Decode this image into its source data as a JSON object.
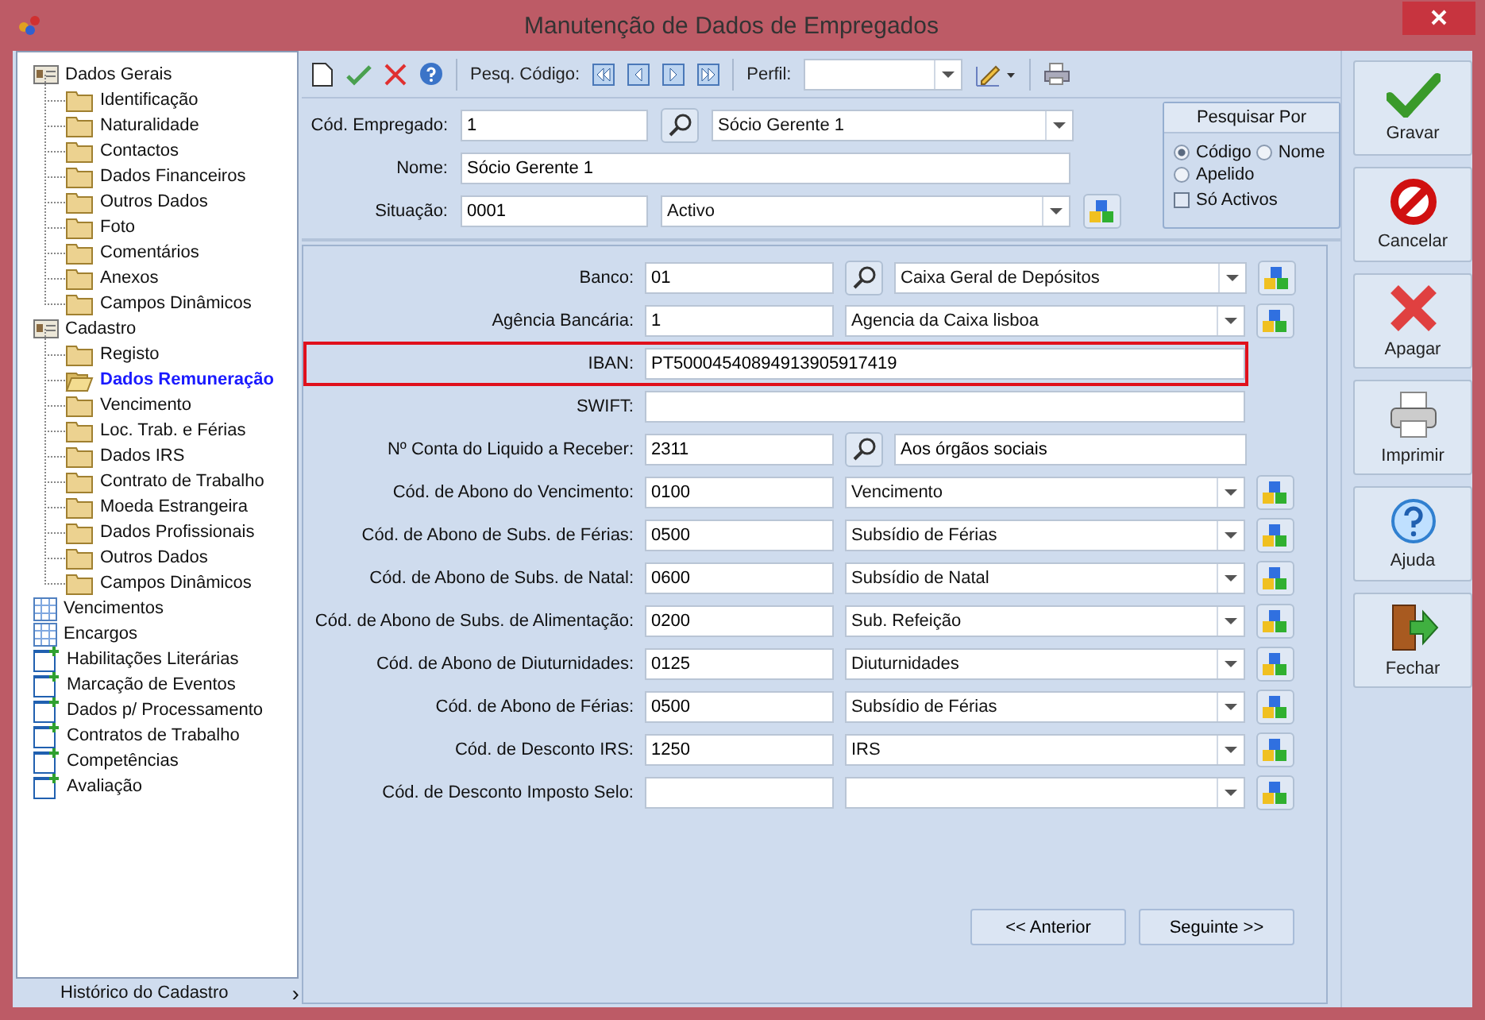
{
  "window": {
    "title": "Manutenção de Dados de Empregados"
  },
  "tree": [
    {
      "label": "Dados Gerais",
      "kind": "group",
      "selected": false,
      "children": [
        {
          "label": "Identificação",
          "kind": "folder",
          "selected": false
        },
        {
          "label": "Naturalidade",
          "kind": "folder",
          "selected": false
        },
        {
          "label": "Contactos",
          "kind": "folder",
          "selected": false
        },
        {
          "label": "Dados Financeiros",
          "kind": "folder",
          "selected": false
        },
        {
          "label": "Outros Dados",
          "kind": "folder",
          "selected": false
        },
        {
          "label": "Foto",
          "kind": "folder",
          "selected": false
        },
        {
          "label": "Comentários",
          "kind": "folder",
          "selected": false
        },
        {
          "label": "Anexos",
          "kind": "folder",
          "selected": false
        },
        {
          "label": "Campos Dinâmicos",
          "kind": "folder",
          "selected": false
        }
      ]
    },
    {
      "label": "Cadastro",
      "kind": "group",
      "selected": false,
      "children": [
        {
          "label": "Registo",
          "kind": "folder",
          "selected": false
        },
        {
          "label": "Dados Remuneração",
          "kind": "folder",
          "selected": true
        },
        {
          "label": "Vencimento",
          "kind": "folder",
          "selected": false
        },
        {
          "label": "Loc. Trab. e Férias",
          "kind": "folder",
          "selected": false
        },
        {
          "label": "Dados IRS",
          "kind": "folder",
          "selected": false
        },
        {
          "label": "Contrato de Trabalho",
          "kind": "folder",
          "selected": false
        },
        {
          "label": "Moeda Estrangeira",
          "kind": "folder",
          "selected": false
        },
        {
          "label": "Dados Profissionais",
          "kind": "folder",
          "selected": false
        },
        {
          "label": "Outros Dados",
          "kind": "folder",
          "selected": false
        },
        {
          "label": "Campos Dinâmicos",
          "kind": "folder",
          "selected": false
        }
      ]
    },
    {
      "label": "Vencimentos",
      "kind": "grid",
      "selected": false
    },
    {
      "label": "Encargos",
      "kind": "grid",
      "selected": false
    },
    {
      "label": "Habilitações Literárias",
      "kind": "form",
      "selected": false
    },
    {
      "label": "Marcação de Eventos",
      "kind": "form",
      "selected": false
    },
    {
      "label": "Dados p/ Processamento",
      "kind": "form",
      "selected": false
    },
    {
      "label": "Contratos de Trabalho",
      "kind": "form",
      "selected": false
    },
    {
      "label": "Competências",
      "kind": "form",
      "selected": false
    },
    {
      "label": "Avaliação",
      "kind": "form",
      "selected": false
    }
  ],
  "tree_footer": "Histórico do Cadastro",
  "tree_footer_arrow": "›",
  "toolbar": {
    "search_label": "Pesq. Código:",
    "profile_label": "Perfil:"
  },
  "header_form": {
    "employee": {
      "label": "Cód. Empregado:",
      "code": "1",
      "name": "Sócio Gerente 1"
    },
    "name": {
      "label": "Nome:",
      "value": "Sócio Gerente 1"
    },
    "status": {
      "label": "Situação:",
      "code": "0001",
      "name": "Activo"
    }
  },
  "search_by": {
    "title": "Pesquisar Por",
    "options": [
      {
        "label": "Código",
        "selected": true
      },
      {
        "label": "Nome",
        "selected": false
      },
      {
        "label": "Apelido",
        "selected": false
      }
    ],
    "active_only": {
      "label": "Só Activos",
      "checked": false
    }
  },
  "fields": [
    {
      "kind": "lookup-combo",
      "label": "Banco:",
      "code": "01",
      "value": "Caixa Geral de Depósitos",
      "highlighted": false
    },
    {
      "kind": "combo",
      "label": "Agência Bancária:",
      "code": "1",
      "value": "Agencia da Caixa lisboa",
      "highlighted": false
    },
    {
      "kind": "wide",
      "label": "IBAN:",
      "value": "PT50004540894913905917419",
      "highlighted": true
    },
    {
      "kind": "wide",
      "label": "SWIFT:",
      "highlighted": false
    },
    {
      "kind": "lookup-text",
      "label": "Nº Conta do Liquido a Receber:",
      "code": "2311",
      "value": "Aos órgãos sociais",
      "highlighted": false
    },
    {
      "kind": "combo",
      "label": "Cód. de Abono do Vencimento:",
      "code": "0100",
      "value": "Vencimento",
      "highlighted": false
    },
    {
      "kind": "combo",
      "label": "Cód. de Abono de Subs. de Férias:",
      "code": "0500",
      "value": "Subsídio de Férias",
      "highlighted": false
    },
    {
      "kind": "combo",
      "label": "Cód. de Abono de Subs. de Natal:",
      "code": "0600",
      "value": "Subsídio de Natal",
      "highlighted": false
    },
    {
      "kind": "combo",
      "label": "Cód. de Abono de Subs. de Alimentação:",
      "code": "0200",
      "value": "Sub. Refeição",
      "highlighted": false
    },
    {
      "kind": "combo",
      "label": "Cód. de Abono de Diuturnidades:",
      "code": "0125",
      "value": "Diuturnidades",
      "highlighted": false
    },
    {
      "kind": "combo",
      "label": "Cód. de Abono de Férias:",
      "code": "0500",
      "value": "Subsídio de Férias",
      "highlighted": false
    },
    {
      "kind": "combo",
      "label": "Cód. de Desconto IRS:",
      "code": "1250",
      "value": "IRS",
      "highlighted": false
    },
    {
      "kind": "combo",
      "label": "Cód. de Desconto Imposto Selo:",
      "highlighted": false
    }
  ],
  "nav_buttons": [
    "<< Anterior",
    "Seguinte >>"
  ],
  "actions": [
    {
      "label": "Gravar",
      "kind": "save"
    },
    {
      "label": "Cancelar",
      "kind": "cancel"
    },
    {
      "label": "Apagar",
      "kind": "delete"
    },
    {
      "label": "Imprimir",
      "kind": "print"
    },
    {
      "label": "Ajuda",
      "kind": "help"
    },
    {
      "label": "Fechar",
      "kind": "close"
    }
  ]
}
